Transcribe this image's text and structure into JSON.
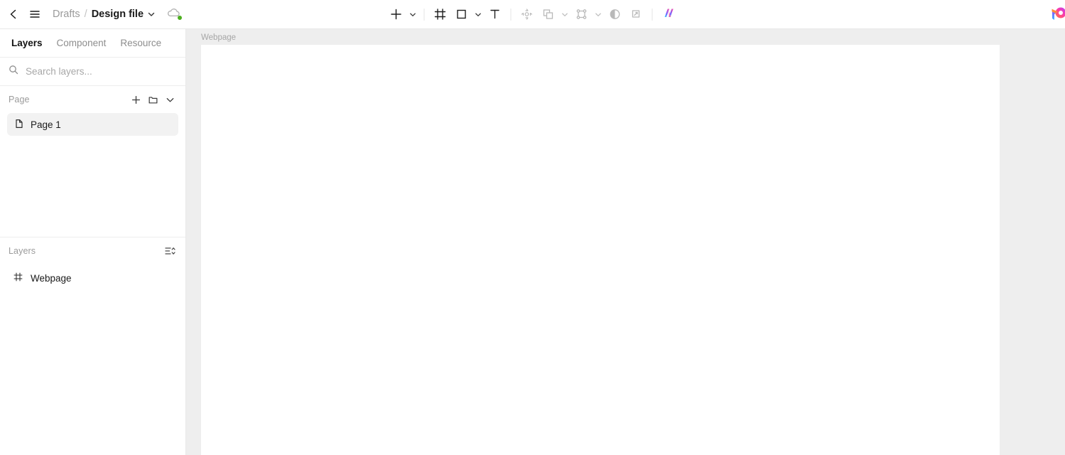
{
  "topbar": {
    "back_icon": "chevron-left-icon",
    "menu_icon": "hamburger-menu-icon",
    "breadcrumb": {
      "parent": "Drafts",
      "separator": "/",
      "file": "Design file",
      "caret_icon": "chevron-down-icon"
    },
    "save_status": {
      "icon": "cloud-icon",
      "indicator_color": "#4caf1f"
    },
    "tools": [
      {
        "name": "add-tool",
        "icon": "plus-icon",
        "has_caret": true,
        "dim": false
      },
      {
        "name": "frame-tool",
        "icon": "frame-icon",
        "has_caret": false,
        "dim": false
      },
      {
        "name": "shape-tool",
        "icon": "square-icon",
        "has_caret": true,
        "dim": false
      },
      {
        "name": "text-tool",
        "icon": "text-t-icon",
        "has_caret": false,
        "dim": false
      },
      {
        "name": "transform-tool",
        "icon": "move-anchor-icon",
        "has_caret": false,
        "dim": true
      },
      {
        "name": "boolean-tool",
        "icon": "union-shapes-icon",
        "has_caret": true,
        "dim": true
      },
      {
        "name": "vector-node-tool",
        "icon": "vector-nodes-icon",
        "has_caret": true,
        "dim": true
      },
      {
        "name": "mask-tool",
        "icon": "half-circle-icon",
        "has_caret": false,
        "dim": true
      },
      {
        "name": "crop-tool",
        "icon": "crop-scale-icon",
        "has_caret": false,
        "dim": true
      }
    ],
    "ai_button": {
      "name": "ai-assistant-button",
      "icon": "ai-sparkle-logo-icon"
    },
    "account": {
      "name": "account-avatar",
      "icon": "profile-logo-icon"
    }
  },
  "sidebar": {
    "tabs": [
      {
        "label": "Layers",
        "active": true
      },
      {
        "label": "Component",
        "active": false
      },
      {
        "label": "Resource",
        "active": false
      }
    ],
    "search": {
      "placeholder": "Search layers...",
      "value": "",
      "icon": "search-icon"
    },
    "page_section": {
      "title": "Page",
      "actions": [
        {
          "name": "add-page-button",
          "icon": "plus-icon"
        },
        {
          "name": "new-folder-button",
          "icon": "folder-icon"
        },
        {
          "name": "collapse-pages-button",
          "icon": "chevron-down-icon"
        }
      ],
      "pages": [
        {
          "label": "Page 1",
          "icon": "page-file-icon",
          "selected": true
        }
      ]
    },
    "layers_section": {
      "title": "Layers",
      "actions": [
        {
          "name": "layer-sort-options-button",
          "icon": "sort-list-icon"
        }
      ],
      "layers": [
        {
          "label": "Webpage",
          "icon": "frame-icon",
          "selected": false
        }
      ]
    }
  },
  "canvas": {
    "frame_label": "Webpage",
    "background_color": "#eeeeee",
    "frame_fill": "#ffffff"
  }
}
